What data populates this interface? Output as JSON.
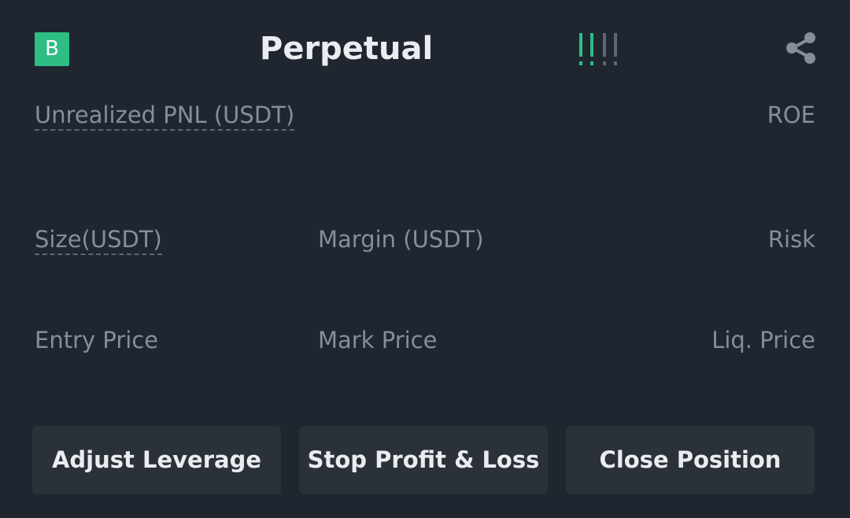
{
  "header": {
    "side_badge": "B",
    "symbol": "Perpetual",
    "risk_meter_icon": "risk-level-bars-icon",
    "share_icon": "share-icon"
  },
  "pnl_row": {
    "unrealized_pnl_label": "Unrealized PNL (USDT)",
    "roe_label": "ROE"
  },
  "size_row": {
    "size_label": "Size(USDT)",
    "margin_label": "Margin (USDT)",
    "risk_label": "Risk"
  },
  "price_row": {
    "entry_price_label": "Entry Price",
    "mark_price_label": "Mark Price",
    "liq_price_label": "Liq. Price"
  },
  "actions": {
    "adjust_leverage": "Adjust Leverage",
    "stop_profit_loss": "Stop Profit & Loss",
    "close_position": "Close Position"
  },
  "colors": {
    "background": "#1f2630",
    "accent_green": "#2ebd85",
    "label_gray": "#848e9c",
    "button_bg": "#2b3139",
    "text_primary": "#eaecef"
  }
}
